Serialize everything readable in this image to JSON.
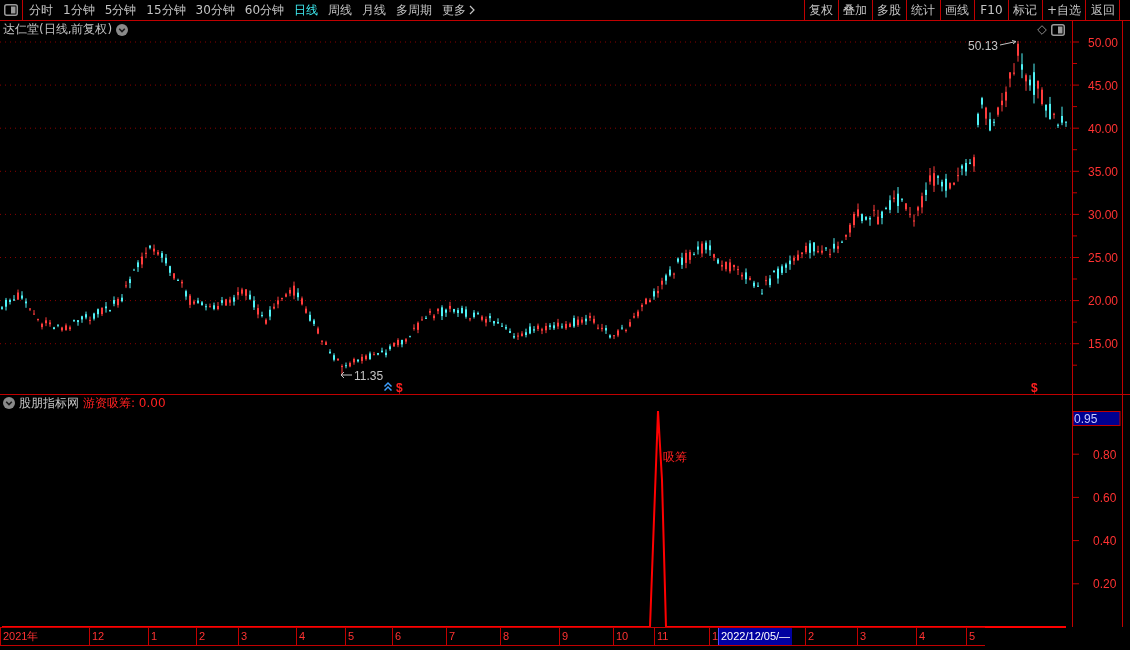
{
  "toolbar": {
    "period_tabs": [
      {
        "label": "分时",
        "kind": "period",
        "selected": false
      },
      {
        "label": "1分钟",
        "kind": "period",
        "selected": false
      },
      {
        "label": "5分钟",
        "kind": "period",
        "selected": false
      },
      {
        "label": "15分钟",
        "kind": "period",
        "selected": false
      },
      {
        "label": "30分钟",
        "kind": "period",
        "selected": false
      },
      {
        "label": "60分钟",
        "kind": "period",
        "selected": false
      },
      {
        "label": "日线",
        "kind": "period",
        "selected": true
      },
      {
        "label": "周线",
        "kind": "period",
        "selected": false
      },
      {
        "label": "月线",
        "kind": "period",
        "selected": false
      },
      {
        "label": "多周期",
        "kind": "period",
        "selected": false
      },
      {
        "label": "更多",
        "kind": "menu",
        "selected": false
      }
    ],
    "tool_buttons": [
      "复权",
      "叠加",
      "多股",
      "统计",
      "画线",
      "F10",
      "标记",
      "+自选",
      "返回"
    ]
  },
  "price_chart": {
    "title": "达仁堂(日线,前复权)",
    "axis_labels": [
      "50.00",
      "45.00",
      "40.00",
      "35.00",
      "30.00",
      "25.00",
      "20.00",
      "15.00"
    ],
    "high_label": "50.13",
    "low_label": "11.35",
    "signal_marks": [
      "$",
      "$"
    ]
  },
  "indicator_panel": {
    "source": "股朋指标网",
    "reading": "游资吸筹: 0.00",
    "top_label": "0.95",
    "chart_data": {
      "type": "line",
      "categories": [
        null,
        null,
        null,
        null,
        null,
        null,
        null,
        null,
        null,
        null,
        null,
        null,
        null,
        null,
        null,
        null,
        null,
        null,
        null,
        null,
        null,
        null,
        null,
        null,
        null,
        null,
        null,
        null,
        null,
        null,
        null,
        null,
        null,
        null,
        null,
        null,
        null,
        null,
        null,
        null,
        null,
        null,
        null,
        null,
        null,
        null,
        null,
        null,
        null,
        null,
        null,
        null,
        null,
        null,
        null,
        null,
        null,
        null,
        null,
        null,
        null,
        null,
        null,
        null,
        null,
        null,
        null,
        null,
        null,
        null,
        null,
        null,
        null,
        null,
        null,
        null,
        null,
        null,
        null,
        null,
        null,
        null,
        null,
        null,
        null,
        null,
        null,
        null,
        null,
        null,
        null,
        null,
        null,
        null,
        null,
        null,
        null,
        null,
        null,
        null,
        null,
        null,
        null,
        null,
        null,
        null,
        null,
        null,
        null,
        null,
        null,
        null,
        null,
        null,
        null,
        null,
        null,
        null,
        null,
        null,
        null,
        null,
        null,
        null,
        null,
        null,
        null,
        null,
        null,
        null,
        null,
        null,
        null,
        null,
        null,
        null,
        null,
        null,
        null,
        null,
        null,
        null,
        null,
        null,
        null,
        null,
        null,
        null,
        null,
        null,
        null,
        null,
        null,
        null,
        null,
        null,
        null,
        null,
        null,
        null,
        null,
        null,
        null,
        null,
        null,
        null,
        null,
        null,
        null,
        null,
        null,
        null,
        null,
        null,
        null,
        null,
        null,
        null,
        null,
        null,
        null,
        null,
        null,
        null,
        null,
        null,
        null,
        null,
        null,
        null,
        null,
        null,
        null,
        null,
        null,
        null,
        null,
        null,
        null,
        null,
        null,
        null,
        null,
        null,
        null,
        null,
        null,
        null,
        null,
        null,
        null,
        null,
        null,
        null,
        null,
        null,
        null,
        null,
        null,
        null,
        null,
        null,
        null,
        null,
        null,
        null,
        null,
        null,
        null,
        null,
        null,
        null,
        null,
        null,
        null,
        null,
        null,
        null,
        null,
        null,
        null,
        null,
        null,
        null,
        null,
        null,
        null,
        null,
        null,
        null,
        null,
        null,
        null,
        null,
        null,
        null,
        null,
        null,
        null,
        null,
        null,
        null,
        null,
        null,
        null,
        null,
        null
      ],
      "series": [
        {
          "color": "#ff0000",
          "values": [
            0,
            0,
            0,
            0,
            0,
            0,
            0,
            0,
            0,
            0,
            0,
            0,
            0,
            0,
            0,
            0,
            0,
            0,
            0,
            0,
            0,
            0,
            0,
            0,
            0,
            0,
            0,
            0,
            0,
            0,
            0,
            0,
            0,
            0,
            0,
            0,
            0,
            0,
            0,
            0,
            0,
            0,
            0,
            0,
            0,
            0,
            0,
            0,
            0,
            0,
            0,
            0,
            0,
            0,
            0,
            0,
            0,
            0,
            0,
            0,
            0,
            0,
            0,
            0,
            0,
            0,
            0,
            0,
            0,
            0,
            0,
            0,
            0,
            0,
            0,
            0,
            0,
            0,
            0,
            0,
            0,
            0,
            0,
            0,
            0,
            0,
            0,
            0,
            0,
            0,
            0,
            0,
            0,
            0,
            0,
            0,
            0,
            0,
            0,
            0,
            0,
            0,
            0,
            0,
            0,
            0,
            0,
            0,
            0,
            0,
            0,
            0,
            0,
            0,
            0,
            0,
            0,
            0,
            0,
            0,
            0,
            0,
            0,
            0,
            0,
            0,
            0,
            0,
            0,
            0,
            0,
            0,
            0,
            0,
            0,
            0,
            0,
            0,
            0,
            0,
            0,
            0,
            0,
            0,
            0,
            0,
            0,
            0,
            0,
            0,
            0,
            0,
            0,
            0,
            0,
            0,
            0,
            0,
            0,
            0,
            0,
            0,
            0,
            0.5,
            1,
            0.68,
            0,
            0,
            0,
            0,
            0,
            0,
            0,
            0,
            0,
            0,
            0,
            0,
            0,
            0,
            0,
            0,
            0,
            0,
            0,
            0,
            0,
            0,
            0,
            0,
            0,
            0,
            0,
            0,
            0,
            0,
            0,
            0,
            0,
            0,
            0,
            0,
            0,
            0,
            0,
            0,
            0,
            0,
            0,
            0,
            0,
            0,
            0,
            0,
            0,
            0,
            0,
            0,
            0,
            0,
            0,
            0,
            0,
            0,
            0,
            0,
            0,
            0,
            0,
            0,
            0,
            0,
            0,
            0,
            0,
            0,
            0,
            0,
            0,
            0,
            0,
            0,
            0,
            0,
            0,
            0,
            0,
            0,
            0,
            0,
            0,
            0,
            0,
            0,
            0,
            0,
            0,
            0,
            0,
            0,
            0,
            0,
            0,
            0,
            0,
            0,
            0
          ]
        }
      ],
      "ylim": [
        0,
        1
      ],
      "yticks": [
        {
          "value": 0.2,
          "label": "0.20"
        },
        {
          "value": 0.4,
          "label": "0.40"
        },
        {
          "value": 0.6,
          "label": "0.60"
        },
        {
          "value": 0.8,
          "label": "0.80"
        }
      ],
      "annotations": [
        {
          "text": "吸筹"
        }
      ]
    }
  },
  "date_axis": [
    {
      "label": "2021年",
      "kind": "tick"
    },
    {
      "label": "12",
      "kind": "tick"
    },
    {
      "label": "1",
      "kind": "tick"
    },
    {
      "label": "2",
      "kind": "tick"
    },
    {
      "label": "3",
      "kind": "tick"
    },
    {
      "label": "4",
      "kind": "tick"
    },
    {
      "label": "5",
      "kind": "tick"
    },
    {
      "label": "6",
      "kind": "tick"
    },
    {
      "label": "7",
      "kind": "tick"
    },
    {
      "label": "8",
      "kind": "tick"
    },
    {
      "label": "9",
      "kind": "tick"
    },
    {
      "label": "10",
      "kind": "tick"
    },
    {
      "label": "11",
      "kind": "tick"
    },
    {
      "label": "1",
      "kind": "tick"
    },
    {
      "label": "2022/12/05/—",
      "kind": "cursor"
    },
    {
      "label": "2",
      "kind": "tick"
    },
    {
      "label": "3",
      "kind": "tick"
    },
    {
      "label": "4",
      "kind": "tick"
    },
    {
      "label": "5",
      "kind": "tick"
    }
  ]
}
